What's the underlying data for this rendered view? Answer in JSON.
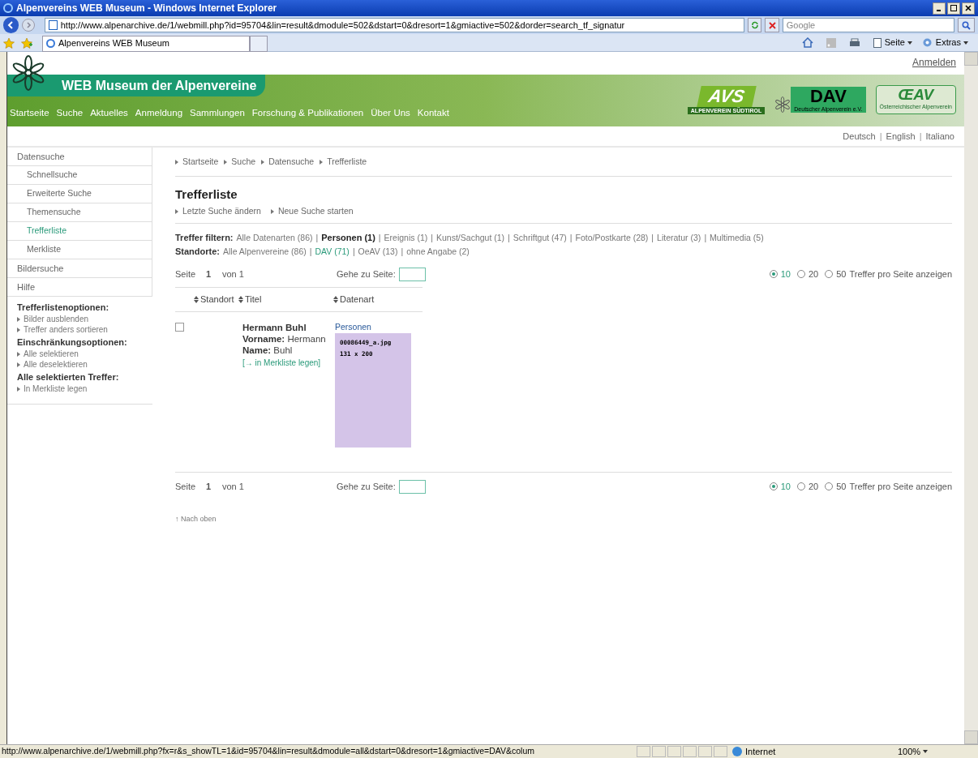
{
  "window": {
    "title": "Alpenvereins WEB Museum - Windows Internet Explorer"
  },
  "address_bar": {
    "url": "http://www.alpenarchive.de/1/webmill.php?id=95704&lin=result&dmodule=502&dstart=0&dresort=1&gmiactive=502&dorder=search_tf_signatur",
    "search_placeholder": "Google"
  },
  "tab": {
    "title": "Alpenvereins WEB Museum"
  },
  "toolbar": [
    "Seite",
    "Extras"
  ],
  "site": {
    "title": "WEB Museum der Alpenvereine",
    "login": "Anmelden",
    "nav": [
      "Startseite",
      "Suche",
      "Aktuelles",
      "Anmeldung",
      "Sammlungen",
      "Forschung & Publikationen",
      "Über Uns",
      "Kontakt"
    ],
    "logos": [
      {
        "kind": "avs",
        "mark": "AVS",
        "caption": "ALPENVEREIN SÜDTIROL"
      },
      {
        "kind": "dav",
        "mark": "DAV",
        "caption": "Deutscher Alpenverein e.V."
      },
      {
        "kind": "oeav",
        "mark": "ŒAV",
        "caption": "Österreichischer Alpenverein"
      }
    ],
    "languages": [
      "Deutsch",
      "English",
      "Italiano"
    ],
    "language_separator": "|"
  },
  "sidebar": {
    "items": [
      {
        "label": "Datensuche",
        "selected": false,
        "children": [
          {
            "label": "Schnellsuche",
            "selected": false
          },
          {
            "label": "Erweiterte Suche",
            "selected": false
          },
          {
            "label": "Themensuche",
            "selected": false
          },
          {
            "label": "Trefferliste",
            "selected": true
          },
          {
            "label": "Merkliste",
            "selected": false
          }
        ]
      },
      {
        "label": "Bildersuche",
        "selected": false
      },
      {
        "label": "Hilfe",
        "selected": false
      }
    ],
    "sections": [
      {
        "title": "Trefferlistenoptionen:",
        "links": [
          "Bilder ausblenden",
          "Treffer anders sortieren"
        ]
      },
      {
        "title": "Einschränkungsoptionen:",
        "links": [
          "Alle selektieren",
          "Alle deselektieren"
        ]
      },
      {
        "title": "Alle selektierten Treffer:",
        "links": [
          "In Merkliste legen"
        ]
      }
    ]
  },
  "breadcrumb": [
    "Startseite",
    "Suche",
    "Datensuche",
    "Trefferliste"
  ],
  "heading": "Trefferliste",
  "actions": [
    "Letzte Suche ändern",
    "Neue Suche starten"
  ],
  "filters": [
    {
      "kind": "type",
      "label": "Treffer filtern:",
      "separator": "|",
      "items": [
        {
          "label": "Alle Datenarten (86)",
          "selected": false
        },
        {
          "label": "Personen (1)",
          "selected": true
        },
        {
          "label": "Ereignis (1)",
          "selected": false
        },
        {
          "label": "Kunst/Sachgut (1)",
          "selected": false
        },
        {
          "label": "Schriftgut (47)",
          "selected": false
        },
        {
          "label": "Foto/Postkarte (28)",
          "selected": false
        },
        {
          "label": "Literatur (3)",
          "selected": false
        },
        {
          "label": "Multimedia (5)",
          "selected": false
        }
      ]
    },
    {
      "kind": "location",
      "label": "Standorte:",
      "separator": "|",
      "items": [
        {
          "label": "Alle Alpenvereine (86)",
          "selected": false
        },
        {
          "label": "DAV (71)",
          "selected": true
        },
        {
          "label": "OeAV (13)",
          "selected": false
        },
        {
          "label": "ohne Angabe (2)",
          "selected": false
        }
      ]
    }
  ],
  "pagers": [
    {
      "page_label": "Seite",
      "page": "1",
      "of": "von 1",
      "goto_label": "Gehe zu Seite:",
      "per_page": [
        {
          "label": "10",
          "selected": true
        },
        {
          "label": "20",
          "selected": false
        },
        {
          "label": "50",
          "selected": false
        }
      ],
      "per_page_suffix": "Treffer pro Seite anzeigen"
    },
    {
      "page_label": "Seite",
      "page": "1",
      "of": "von 1",
      "goto_label": "Gehe zu Seite:",
      "per_page": [
        {
          "label": "10",
          "selected": true
        },
        {
          "label": "20",
          "selected": false
        },
        {
          "label": "50",
          "selected": false
        }
      ],
      "per_page_suffix": "Treffer pro Seite anzeigen"
    }
  ],
  "table": {
    "columns": [
      "Standort",
      "Titel",
      "Datenart"
    ],
    "rows": [
      {
        "checked": false,
        "title": "Hermann Buhl",
        "fields": [
          {
            "label": "Vorname:",
            "value": "Hermann"
          },
          {
            "label": "Name:",
            "value": "Buhl"
          }
        ],
        "link": "[→ in Merkliste legen]",
        "type": "Personen",
        "thumbnail": [
          "00086449_a.jpg",
          "131 x 200"
        ]
      }
    ]
  },
  "back_to_top": "↑ Nach oben",
  "status_bar": {
    "url": "http://www.alpenarchive.de/1/webmill.php?fx=r&s_showTL=1&id=95704&lin=result&dmodule=all&dstart=0&dresort=1&gmiactive=DAV&colum",
    "zone": "Internet",
    "zoom": "100%"
  }
}
